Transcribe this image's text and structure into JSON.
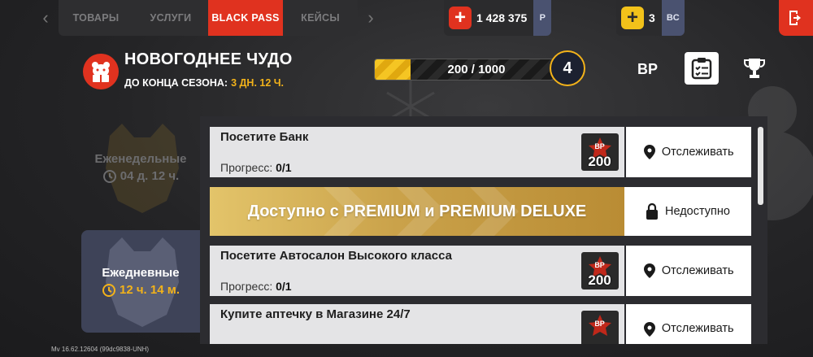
{
  "nav": {
    "tabs": [
      {
        "label": "ТОВАРЫ",
        "active": false
      },
      {
        "label": "УСЛУГИ",
        "active": false
      },
      {
        "label": "BLACK PASS",
        "active": true
      },
      {
        "label": "КЕЙСЫ",
        "active": false
      }
    ]
  },
  "currency": {
    "rubles": {
      "value": "1 428 375",
      "tag": "Р"
    },
    "bc": {
      "value": "3",
      "tag": "BC"
    }
  },
  "season": {
    "title": "НОВОГОДНЕЕ ЧУДО",
    "timer_label": "ДО КОНЦА СЕЗОНА:",
    "timer_value": "3 ДН. 12 Ч.",
    "progress_text": "200 / 1000",
    "progress_fraction": 0.2,
    "level": "4",
    "bp_label": "BP"
  },
  "categories": [
    {
      "name": "Еженедельные",
      "time": "04 д. 12 ч.",
      "active": false
    },
    {
      "name": "Ежедневные",
      "time": "12 ч. 14 м.",
      "active": true
    }
  ],
  "tasks": [
    {
      "title": "Посетите Банк",
      "progress_label": "Прогресс:",
      "progress_value": "0/1",
      "reward_label": "BP",
      "reward_points": "200",
      "action": "Отслеживать"
    },
    {
      "title": "Посетите Автосалон Высокого класса",
      "progress_label": "Прогресс:",
      "progress_value": "0/1",
      "reward_label": "BP",
      "reward_points": "200",
      "action": "Отслеживать"
    },
    {
      "title": "Купите аптечку в Магазине 24/7",
      "progress_label": "",
      "progress_value": "",
      "reward_label": "BP",
      "reward_points": "",
      "action": "Отслеживать"
    }
  ],
  "premium": {
    "text": "Доступно с PREMIUM и PREMIUM DELUXE",
    "action": "Недоступно"
  },
  "version": "Mv 16.62.12604 (99dc9838-UNH)",
  "colors": {
    "accent": "#e0321f",
    "gold": "#f2b21a",
    "dark": "#242426"
  }
}
